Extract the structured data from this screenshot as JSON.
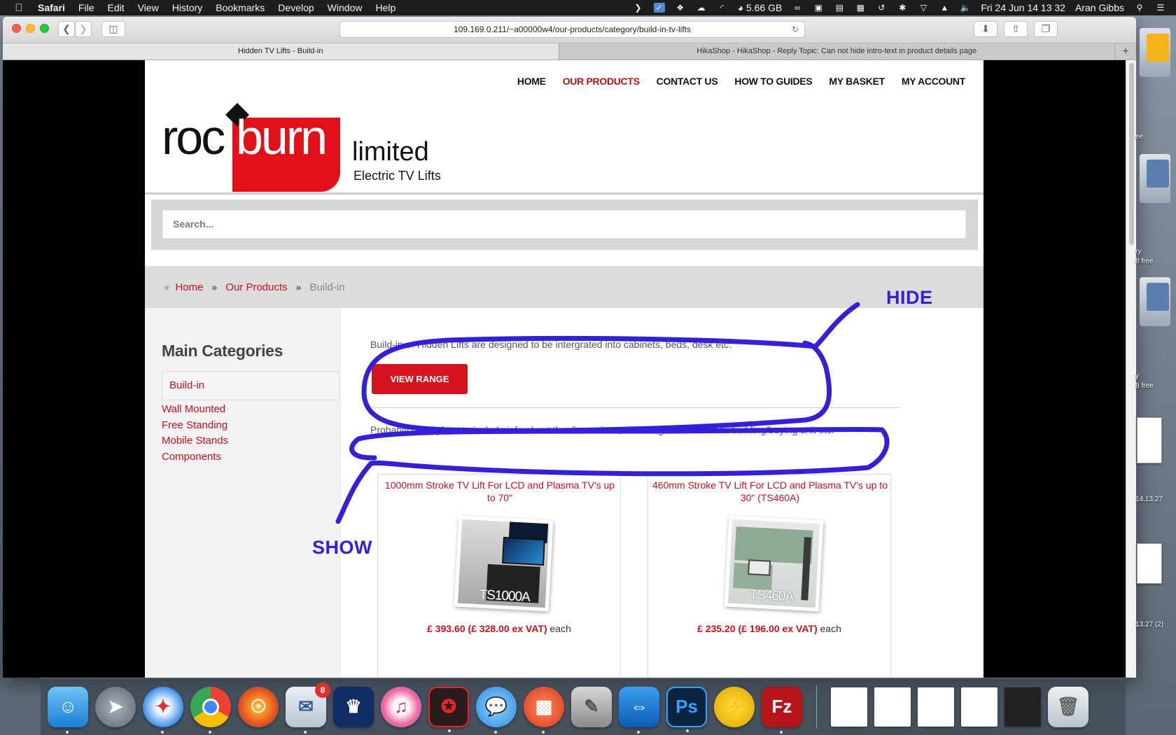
{
  "menubar": {
    "app": "Safari",
    "items": [
      "File",
      "Edit",
      "View",
      "History",
      "Bookmarks",
      "Develop",
      "Window",
      "Help"
    ],
    "memory": "5.66 GB",
    "datetime": "Fri 24 Jun  14 13 32",
    "user": "Aran Gibbs"
  },
  "browser": {
    "url": "109.169.0.211/~a00000w4/our-products/category/build-in-tv-lifts",
    "tabs": [
      {
        "title": "Hidden TV Lifts - Build-in"
      },
      {
        "title": "HikaShop - HikaShop - Reply Topic: Can not hide intro-text in product details page"
      }
    ]
  },
  "site": {
    "logo": {
      "word1": "roc",
      "word2": "burn",
      "word3": "limited",
      "tagline": "Electric TV Lifts"
    },
    "nav": [
      "HOME",
      "OUR PRODUCTS",
      "CONTACT US",
      "HOW TO GUIDES",
      "MY BASKET",
      "MY ACCOUNT"
    ],
    "nav_active": "OUR PRODUCTS",
    "search": {
      "placeholder": "Search..."
    },
    "breadcrumb": {
      "home": "Home",
      "products": "Our Products",
      "current": "Build-in"
    },
    "sidebar": {
      "heading": "Main Categories",
      "active": "Build-in",
      "items": [
        "Wall Mounted",
        "Free Standing",
        "Mobile Stands",
        "Components"
      ]
    },
    "main": {
      "intro": "Build-in or Hidden Lifts are  designed to be intergrated into cabinets, beds, desk etc.",
      "button": "VIEW RANGE",
      "info": "Probably good place to include info about the dimensions, choosing tv lift BEFORE building/buying unit etc."
    },
    "products": [
      {
        "title": "1000mm Stroke TV Lift For LCD and Plasma TV's up to 70\"",
        "price": "£ 393.60 (£ 328.00 ex VAT)",
        "unit": " each",
        "model": "TS1000A"
      },
      {
        "title": "460mm Stroke TV Lift For LCD and Plasma TV's up to 30\" (TS460A)",
        "price": "£ 235.20 (£ 196.00 ex VAT)",
        "unit": " each",
        "model": "TS460A"
      }
    ]
  },
  "annotations": {
    "hide": "HIDE",
    "show": "SHOW",
    "color": "#3320d8"
  },
  "desktop": {
    "labels": [
      "ee",
      "ry",
      "8 free",
      "y",
      "8 free",
      "14.13.27",
      "13.27 (2)"
    ]
  },
  "dock": {
    "mail_badge": "8",
    "apps": [
      "finder",
      "launchpad",
      "safari",
      "chrome",
      "firefox",
      "mail",
      "kings",
      "itunes",
      "acrobat",
      "messages",
      "screen-share",
      "script-editor",
      "teamviewer",
      "photoshop",
      "winamp",
      "filezilla"
    ]
  },
  "colors": {
    "brand_red": "#c8101c",
    "button_red": "#d4131f",
    "nav_active": "#b81010"
  }
}
